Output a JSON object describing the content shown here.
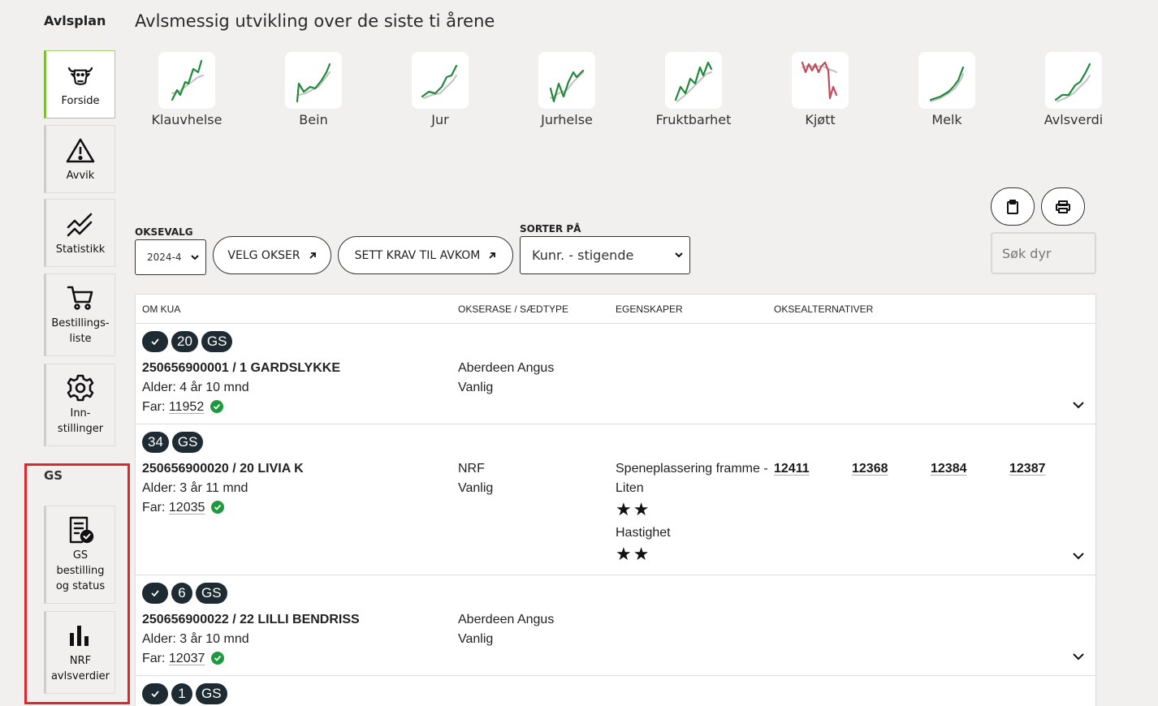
{
  "sidebar": {
    "title": "Avlsplan",
    "items": [
      {
        "label": "Forside",
        "icon": "cow-icon"
      },
      {
        "label": "Avvik",
        "icon": "warning-icon"
      },
      {
        "label": "Statistikk",
        "icon": "trend-chart-icon"
      },
      {
        "label1": "Bestillings-",
        "label2": "liste",
        "icon": "cart-icon"
      },
      {
        "label1": "Inn-",
        "label2": "stillinger",
        "icon": "gear-icon"
      }
    ],
    "gs_title": "GS",
    "gs_items": [
      {
        "label1": "GS",
        "label2": "bestilling",
        "label3": "og status",
        "icon": "document-check-icon"
      },
      {
        "label1": "NRF",
        "label2": "avlsverdier",
        "icon": "bar-chart-icon"
      }
    ]
  },
  "header": {
    "title": "Avlsmessig utvikling over de siste ti årene"
  },
  "trends": [
    {
      "label": "Klauvhelse",
      "color": "#1f8a3a"
    },
    {
      "label": "Bein",
      "color": "#1f8a3a"
    },
    {
      "label": "Jur",
      "color": "#1f8a3a"
    },
    {
      "label": "Jurhelse",
      "color": "#1f8a3a"
    },
    {
      "label": "Fruktbarhet",
      "color": "#1f8a3a"
    },
    {
      "label": "Kjøtt",
      "color": "#c44a5a"
    },
    {
      "label": "Melk",
      "color": "#1f8a3a"
    },
    {
      "label": "Avlsverdi",
      "color": "#1f8a3a"
    }
  ],
  "controls": {
    "oksevalg_label": "OKSEVALG",
    "oksevalg_value": "2024-4",
    "velg_okser": "VELG OKSER",
    "sett_krav": "SETT KRAV TIL AVKOM",
    "sorter_label": "SORTER PÅ",
    "sorter_value": "Kunr. - stigende",
    "search_placeholder": "Søk dyr"
  },
  "table": {
    "headers": [
      "OM KUA",
      "OKSERASE / SÆDTYPE",
      "EGENSKAPER",
      "OKSEALTERNATIVER"
    ],
    "rows": [
      {
        "has_check": true,
        "number": "20",
        "tag": "GS",
        "id": "250656900001 / 1 GARDSLYKKE",
        "age": "Alder: 4 år 10 mnd",
        "far_label": "Far:",
        "far": "11952",
        "race": "Aberdeen Angus",
        "seed": "Vanlig"
      },
      {
        "has_check": false,
        "number": "34",
        "tag": "GS",
        "id": "250656900020 / 20 LIVIA K",
        "age": "Alder: 3 år 11 mnd",
        "far_label": "Far:",
        "far": "12035",
        "race": "NRF",
        "seed": "Vanlig",
        "trait1_a": "Speneplassering framme -",
        "trait1_b": "Liten",
        "trait1_stars": "★★",
        "trait2": "Hastighet",
        "trait2_stars": "★★",
        "bulls": [
          "12411",
          "12368",
          "12384",
          "12387"
        ]
      },
      {
        "has_check": true,
        "number": "6",
        "tag": "GS",
        "id": "250656900022 / 22 LILLI BENDRISS",
        "age": "Alder: 3 år 10 mnd",
        "far_label": "Far:",
        "far": "12037",
        "race": "Aberdeen Angus",
        "seed": "Vanlig"
      },
      {
        "has_check": true,
        "number": "1",
        "tag": "GS"
      }
    ]
  }
}
